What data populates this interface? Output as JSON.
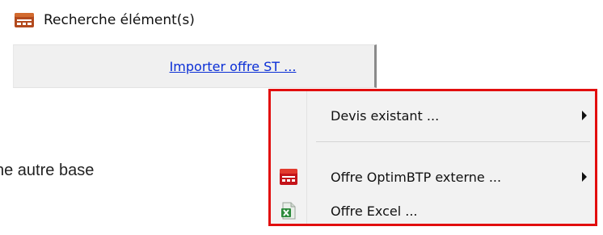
{
  "toolbar": {
    "search_label": "Recherche élément(s)",
    "search_icon": "optimbtp-app-icon"
  },
  "import": {
    "link_label": "Importer offre ST ..."
  },
  "background": {
    "partial_text": "ne autre base"
  },
  "context_menu": {
    "highlight_color": "#e20e0e",
    "items": [
      {
        "label": "Devis existant ...",
        "has_submenu": true,
        "icon": ""
      },
      {
        "label": "Offre OptimBTP externe ...",
        "has_submenu": true,
        "icon": "optimbtp-red-icon"
      },
      {
        "label": "Offre Excel ...",
        "has_submenu": false,
        "icon": "excel-file-icon"
      }
    ]
  }
}
